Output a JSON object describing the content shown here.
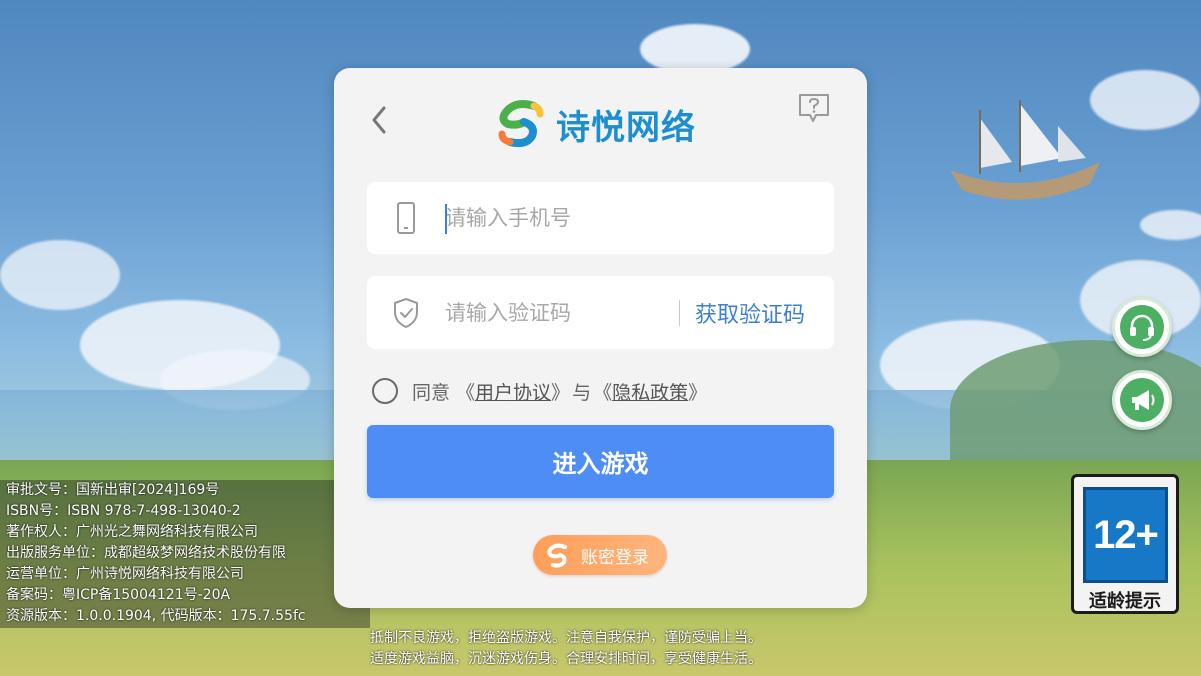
{
  "modal": {
    "brand_name": "诗悦网络",
    "phone_placeholder": "请输入手机号",
    "code_placeholder": "请输入验证码",
    "get_code_label": "获取验证码",
    "agree_prefix": "同意",
    "open_quote_1": "《",
    "user_agreement": "用户协议",
    "close_quote_1": "》",
    "and": "与",
    "open_quote_2": "《",
    "privacy_policy": "隐私政策",
    "close_quote_2": "》",
    "enter_button": "进入游戏",
    "account_login": "账密登录"
  },
  "info_lines": [
    "审批文号：国新出审[2024]169号",
    "ISBN号：ISBN 978-7-498-13040-2",
    "著作权人：广州光之舞网络科技有限公司",
    "出版服务单位：成都超级梦网络技术股份有限",
    "运营单位：广州诗悦网络科技有限公司",
    "备案码：粤ICP备15004121号-20A",
    "资源版本：1.0.0.1904, 代码版本：175.7.55fc"
  ],
  "notice_lines": [
    "抵制不良游戏，拒绝盗版游戏。注意自我保护，谨防受骗上当。",
    "适度游戏益脑，沉迷游戏伤身。合理安排时间，享受健康生活。"
  ],
  "age_rating": {
    "number": "12+",
    "caption": "适龄提示"
  },
  "icons": {
    "back": "chevron-left-icon",
    "help": "question-bubble-icon",
    "phone": "phone-icon",
    "shield": "shield-check-icon",
    "service": "headset-icon",
    "announce": "megaphone-icon"
  },
  "colors": {
    "primary_button": "#4d8df5",
    "link": "#3e7fd6",
    "brand": "#1d8fd0",
    "account_button": "#ff9e5a",
    "side_button": "#4caf63",
    "age_badge": "#1878c8"
  }
}
